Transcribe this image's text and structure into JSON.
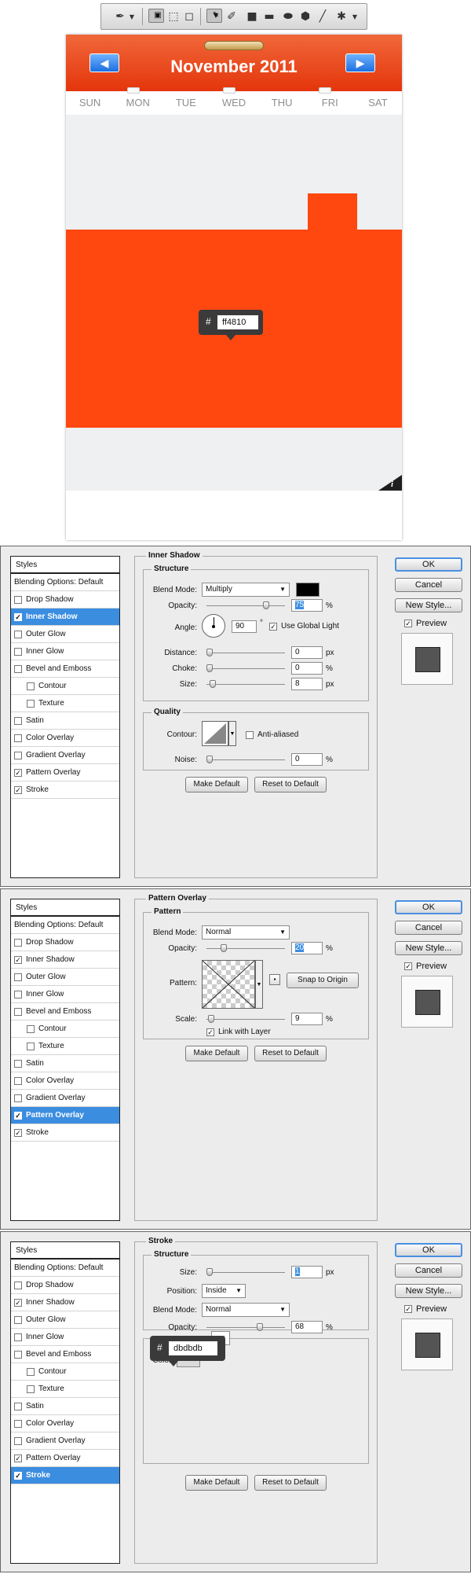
{
  "toolbar": {
    "icons": [
      "pen-tool-icon",
      "chevron-down-icon",
      "shape-layers-icon",
      "paths-icon",
      "fill-pixels-icon",
      "pen-icon",
      "freeform-pen-icon",
      "rectangle-icon",
      "rounded-rectangle-icon",
      "ellipse-icon",
      "polygon-icon",
      "line-icon",
      "custom-shape-icon",
      "chevron-down-icon"
    ]
  },
  "calendar": {
    "month": "November 2011",
    "prev_icon": "arrow-left-icon",
    "next_icon": "arrow-right-icon",
    "days": [
      "SUN",
      "MON",
      "TUE",
      "WED",
      "THU",
      "FRI",
      "SAT"
    ],
    "color_tooltip": {
      "hash": "#",
      "value": "ff4810"
    },
    "info_label": "i",
    "colors": {
      "header": "#e4350c",
      "highlight": "#ff4810",
      "cell": "#eef0f2"
    }
  },
  "common": {
    "styles_title": "Styles",
    "blending": "Blending Options: Default",
    "items": [
      "Drop Shadow",
      "Inner Shadow",
      "Outer Glow",
      "Inner Glow",
      "Bevel and Emboss",
      "Contour",
      "Texture",
      "Satin",
      "Color Overlay",
      "Gradient Overlay",
      "Pattern Overlay",
      "Stroke"
    ],
    "ok": "OK",
    "cancel": "Cancel",
    "new_style": "New Style...",
    "preview": "Preview",
    "make_default": "Make Default",
    "reset_default": "Reset to Default",
    "check": "✓"
  },
  "inner_shadow": {
    "title": "Inner Shadow",
    "structure": "Structure",
    "blend_mode_label": "Blend Mode:",
    "blend_mode": "Multiply",
    "opacity_label": "Opacity:",
    "opacity": "75",
    "angle_label": "Angle:",
    "angle": "90",
    "degree": "°",
    "use_global_light": "Use Global Light",
    "distance_label": "Distance:",
    "distance": "0",
    "choke_label": "Choke:",
    "choke": "0",
    "size_label": "Size:",
    "size": "8",
    "quality": "Quality",
    "contour_label": "Contour:",
    "anti_aliased": "Anti-aliased",
    "noise_label": "Noise:",
    "noise": "0",
    "px": "px",
    "pct": "%"
  },
  "pattern_overlay": {
    "title": "Pattern Overlay",
    "pattern_group": "Pattern",
    "blend_mode_label": "Blend Mode:",
    "blend_mode": "Normal",
    "opacity_label": "Opacity:",
    "opacity": "20",
    "pattern_label": "Pattern:",
    "snap_to_origin": "Snap to Origin",
    "scale_label": "Scale:",
    "scale": "9",
    "link_with_layer": "Link with Layer",
    "pct": "%"
  },
  "stroke": {
    "title": "Stroke",
    "structure": "Structure",
    "size_label": "Size:",
    "size": "1",
    "position_label": "Position:",
    "position": "Inside",
    "blend_mode_label": "Blend Mode:",
    "blend_mode": "Normal",
    "opacity_label": "Opacity:",
    "opacity": "68",
    "color_label": "Color:",
    "color_tooltip": {
      "hash": "#",
      "value": "dbdbdb"
    },
    "px": "px",
    "pct": "%"
  }
}
